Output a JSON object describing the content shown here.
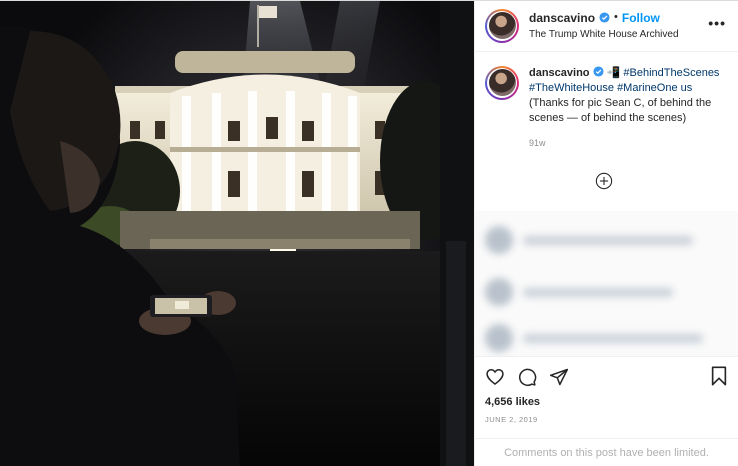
{
  "post": {
    "username": "danscavino",
    "follow_label": "Follow",
    "dot": "•",
    "location": "The Trump White House Archived",
    "more_label": "•••"
  },
  "caption": {
    "username": "danscavino",
    "emoji": "📲",
    "hashtag1": "#BehindTheScenes",
    "hashtag2": "#TheWhiteHouse",
    "hashtag3": "#MarineOne",
    "word_us": "us",
    "text": "(Thanks for pic Sean C, of behind the scenes — of behind the scenes)",
    "time": "91w"
  },
  "engagement": {
    "likes": "4,656 likes",
    "date": "JUNE 2, 2019"
  },
  "footer": {
    "limited_text": "Comments on this post have been limited."
  },
  "icons": {
    "like": "heart-icon",
    "comment": "comment-icon",
    "share": "share-icon",
    "save": "bookmark-icon",
    "plus": "plus-circle-icon",
    "verified": "verified-badge-icon"
  },
  "colors": {
    "link_blue": "#0095f6",
    "hashtag": "#00376b",
    "muted": "#8e8e8e",
    "text": "#262626"
  }
}
